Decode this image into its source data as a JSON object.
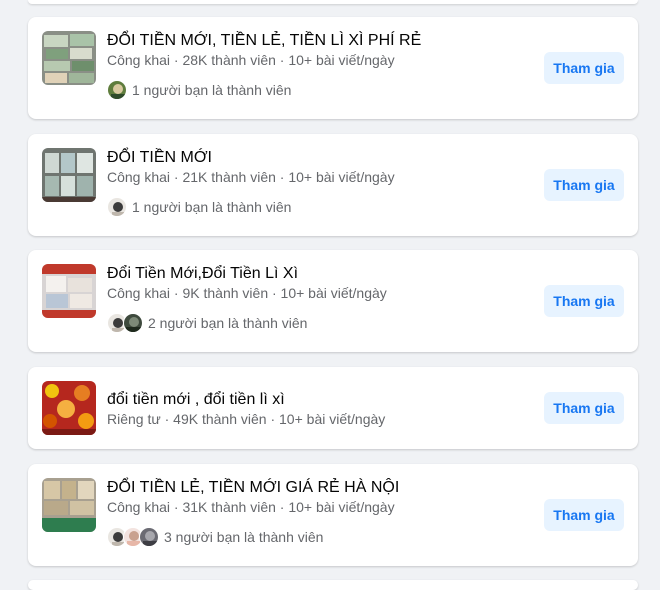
{
  "groups": [
    {
      "name": "ĐỔI TIỀN MỚI, TIỀN LẺ, TIỀN LÌ XÌ PHÍ RẺ",
      "meta": "Công khai · 28K thành viên · 10+ bài viết/ngày",
      "friends_text": "1 người bạn là thành viên",
      "join_label": "Tham gia"
    },
    {
      "name": "ĐỔI TIỀN MỚI",
      "meta": "Công khai · 21K thành viên · 10+ bài viết/ngày",
      "friends_text": "1 người bạn là thành viên",
      "join_label": "Tham gia"
    },
    {
      "name": "Đổi Tiền Mới,Đổi Tiền Lì Xì",
      "meta": "Công khai · 9K thành viên · 10+ bài viết/ngày",
      "friends_text": "2 người bạn là thành viên",
      "join_label": "Tham gia"
    },
    {
      "name": "đổi tiền mới , đổi tiền lì xì",
      "meta": "Riêng tư · 49K thành viên · 10+ bài viết/ngày",
      "join_label": "Tham gia"
    },
    {
      "name": "ĐỔI TIỀN LẺ, TIỀN MỚI GIÁ RẺ HÀ NỘI",
      "meta": "Công khai · 31K thành viên · 10+ bài viết/ngày",
      "friends_text": "3 người bạn là thành viên",
      "join_label": "Tham gia"
    }
  ],
  "colors": {
    "background": "#f0f2f5",
    "card": "#ffffff",
    "join_bg": "#e7f3ff",
    "join_text": "#1877f2",
    "secondary_text": "#65676b"
  }
}
